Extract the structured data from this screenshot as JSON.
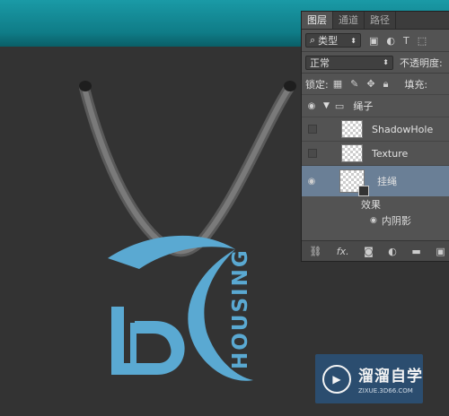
{
  "panel": {
    "tabs": [
      "图层",
      "通道",
      "路径"
    ],
    "filter": {
      "icon": "search-icon",
      "value": "类型"
    },
    "blend_mode": "正常",
    "opacity_label": "不透明度:",
    "lock_label": "锁定:",
    "fill_label": "填充:",
    "group_name": "绳子",
    "layers": [
      {
        "name": "ShadowHole"
      },
      {
        "name": "Texture"
      },
      {
        "name": "挂绳"
      }
    ],
    "effects_label": "效果",
    "effect_item": "内阴影",
    "footer_icons": [
      "link-icon",
      "fx-icon",
      "mask-icon",
      "adjustment-icon",
      "folder-icon",
      "new-layer-icon",
      "trash-icon"
    ],
    "footer_fx": "fx."
  },
  "logo": {
    "text": "HOUSING",
    "mark": "LD",
    "color": "#5aa9d2"
  },
  "watermark": {
    "title": "溜溜自学",
    "url": "ZIXUE.3D66.COM"
  }
}
